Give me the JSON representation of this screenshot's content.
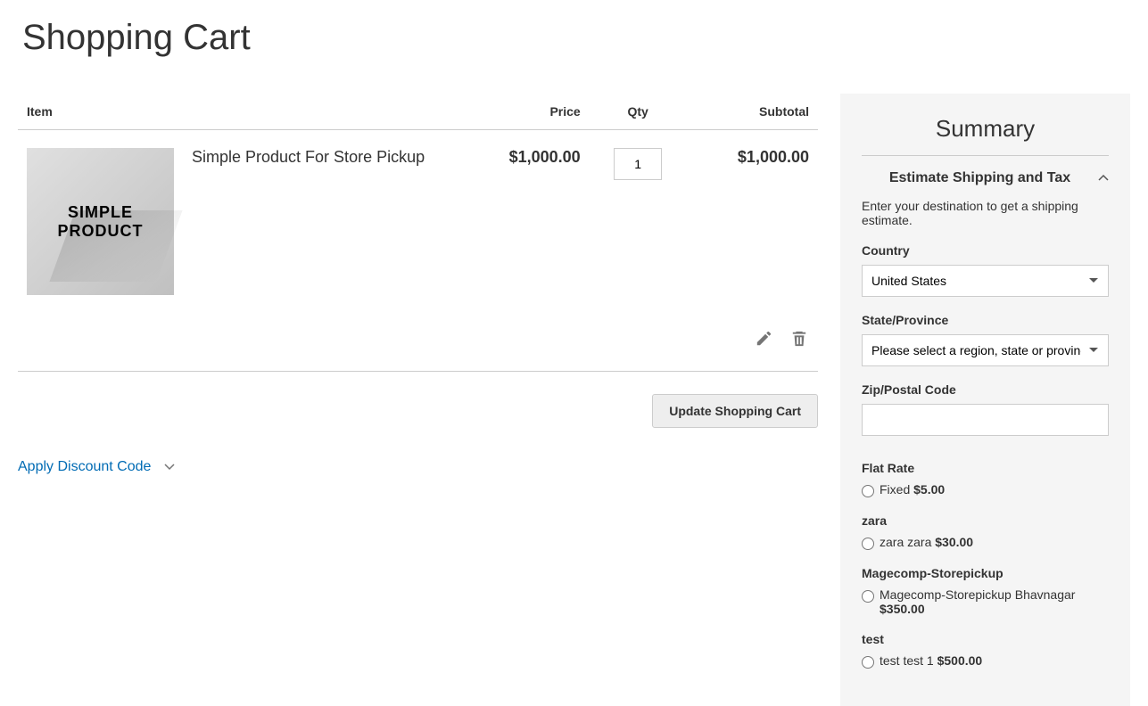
{
  "page": {
    "title": "Shopping Cart"
  },
  "cartTable": {
    "headers": {
      "item": "Item",
      "price": "Price",
      "qty": "Qty",
      "subtotal": "Subtotal"
    },
    "item": {
      "name": "Simple Product For Store Pickup",
      "imageText1": "SIMPLE",
      "imageText2": "PRODUCT",
      "price": "$1,000.00",
      "qty": "1",
      "subtotal": "$1,000.00"
    },
    "updateButton": "Update Shopping Cart"
  },
  "discount": {
    "toggleLabel": "Apply Discount Code"
  },
  "summary": {
    "title": "Summary",
    "estimateTitle": "Estimate Shipping and Tax",
    "estimateDesc": "Enter your destination to get a shipping estimate.",
    "countryLabel": "Country",
    "countryValue": "United States",
    "stateLabel": "State/Province",
    "statePlaceholder": "Please select a region, state or province.",
    "zipLabel": "Zip/Postal Code",
    "zipValue": "",
    "methods": [
      {
        "title": "Flat Rate",
        "optionLabel": "Fixed",
        "price": "$5.00"
      },
      {
        "title": "zara",
        "optionLabel": "zara zara",
        "price": "$30.00"
      },
      {
        "title": "Magecomp-Storepickup",
        "optionLabel": "Magecomp-Storepickup Bhavnagar",
        "price": "$350.00"
      },
      {
        "title": "test",
        "optionLabel": "test test 1",
        "price": "$500.00"
      }
    ]
  }
}
